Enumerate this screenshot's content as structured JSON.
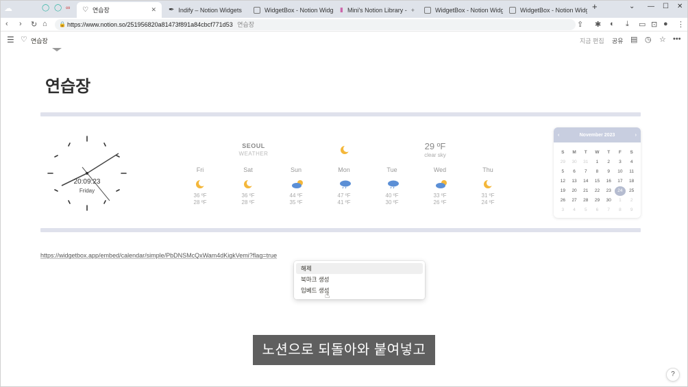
{
  "browser": {
    "tabs": [
      {
        "label": "연습장",
        "icon": "heart-icon",
        "active": true
      },
      {
        "label": "Indify – Notion Widgets",
        "icon": "feather-icon",
        "active": false
      },
      {
        "label": "WidgetBox - Notion Widgets",
        "icon": "widgetbox-icon",
        "active": false
      },
      {
        "label": "Mini's Notion Library - ",
        "icon": "library-icon",
        "active": false
      },
      {
        "label": "WidgetBox - Notion Widgets",
        "icon": "widgetbox-icon",
        "active": false
      },
      {
        "label": "WidgetBox - Notion Widgets",
        "icon": "widgetbox-icon",
        "active": false
      }
    ],
    "url": "https://www.notion.so/251956820a81473f891a84cbcf771d53",
    "url_hint": "연습장"
  },
  "notion": {
    "breadcrumb": "연습장",
    "edit_label": "지금 편집",
    "share_label": "공유",
    "page_title": "연습장"
  },
  "clock": {
    "time": "20:09:23",
    "day": "Friday"
  },
  "weather": {
    "city": "SEOUL",
    "subtitle": "WEATHER",
    "current_temp": "29 ºF",
    "current_sky": "clear sky",
    "days": [
      {
        "name": "Fri",
        "icon": "moon-icon",
        "hi": "36 ºF",
        "lo": "28 ºF"
      },
      {
        "name": "Sat",
        "icon": "moon-icon",
        "hi": "36 ºF",
        "lo": "28 ºF"
      },
      {
        "name": "Sun",
        "icon": "cloud-moon-icon",
        "hi": "44 ºF",
        "lo": "35 ºF"
      },
      {
        "name": "Mon",
        "icon": "rain-cloud-icon",
        "hi": "47 ºF",
        "lo": "41 ºF"
      },
      {
        "name": "Tue",
        "icon": "rain-cloud-icon",
        "hi": "40 ºF",
        "lo": "30 ºF"
      },
      {
        "name": "Wed",
        "icon": "cloud-moon-icon",
        "hi": "33 ºF",
        "lo": "26 ºF"
      },
      {
        "name": "Thu",
        "icon": "moon-icon",
        "hi": "31 ºF",
        "lo": "24 ºF"
      }
    ]
  },
  "calendar": {
    "month": "November 2023",
    "weekdays": [
      "S",
      "M",
      "T",
      "W",
      "T",
      "F",
      "S"
    ],
    "weeks": [
      [
        "29",
        "30",
        "31",
        "1",
        "2",
        "3",
        "4"
      ],
      [
        "5",
        "6",
        "7",
        "8",
        "9",
        "10",
        "11"
      ],
      [
        "12",
        "13",
        "14",
        "15",
        "16",
        "17",
        "18"
      ],
      [
        "19",
        "20",
        "21",
        "22",
        "23",
        "24",
        "25"
      ],
      [
        "26",
        "27",
        "28",
        "29",
        "30",
        "1",
        "2"
      ],
      [
        "3",
        "4",
        "5",
        "6",
        "7",
        "8",
        "9"
      ]
    ],
    "today": "24"
  },
  "embed_link": "https://widgetbox.app/embed/calendar/simple/PbDNSMcQxWam4dKigkVemi?flag=true",
  "context_menu": [
    "해제",
    "북마크 생성",
    "임베드 생성"
  ],
  "subtitle": "노션으로 되돌아와 붙여넣고",
  "help": "?"
}
